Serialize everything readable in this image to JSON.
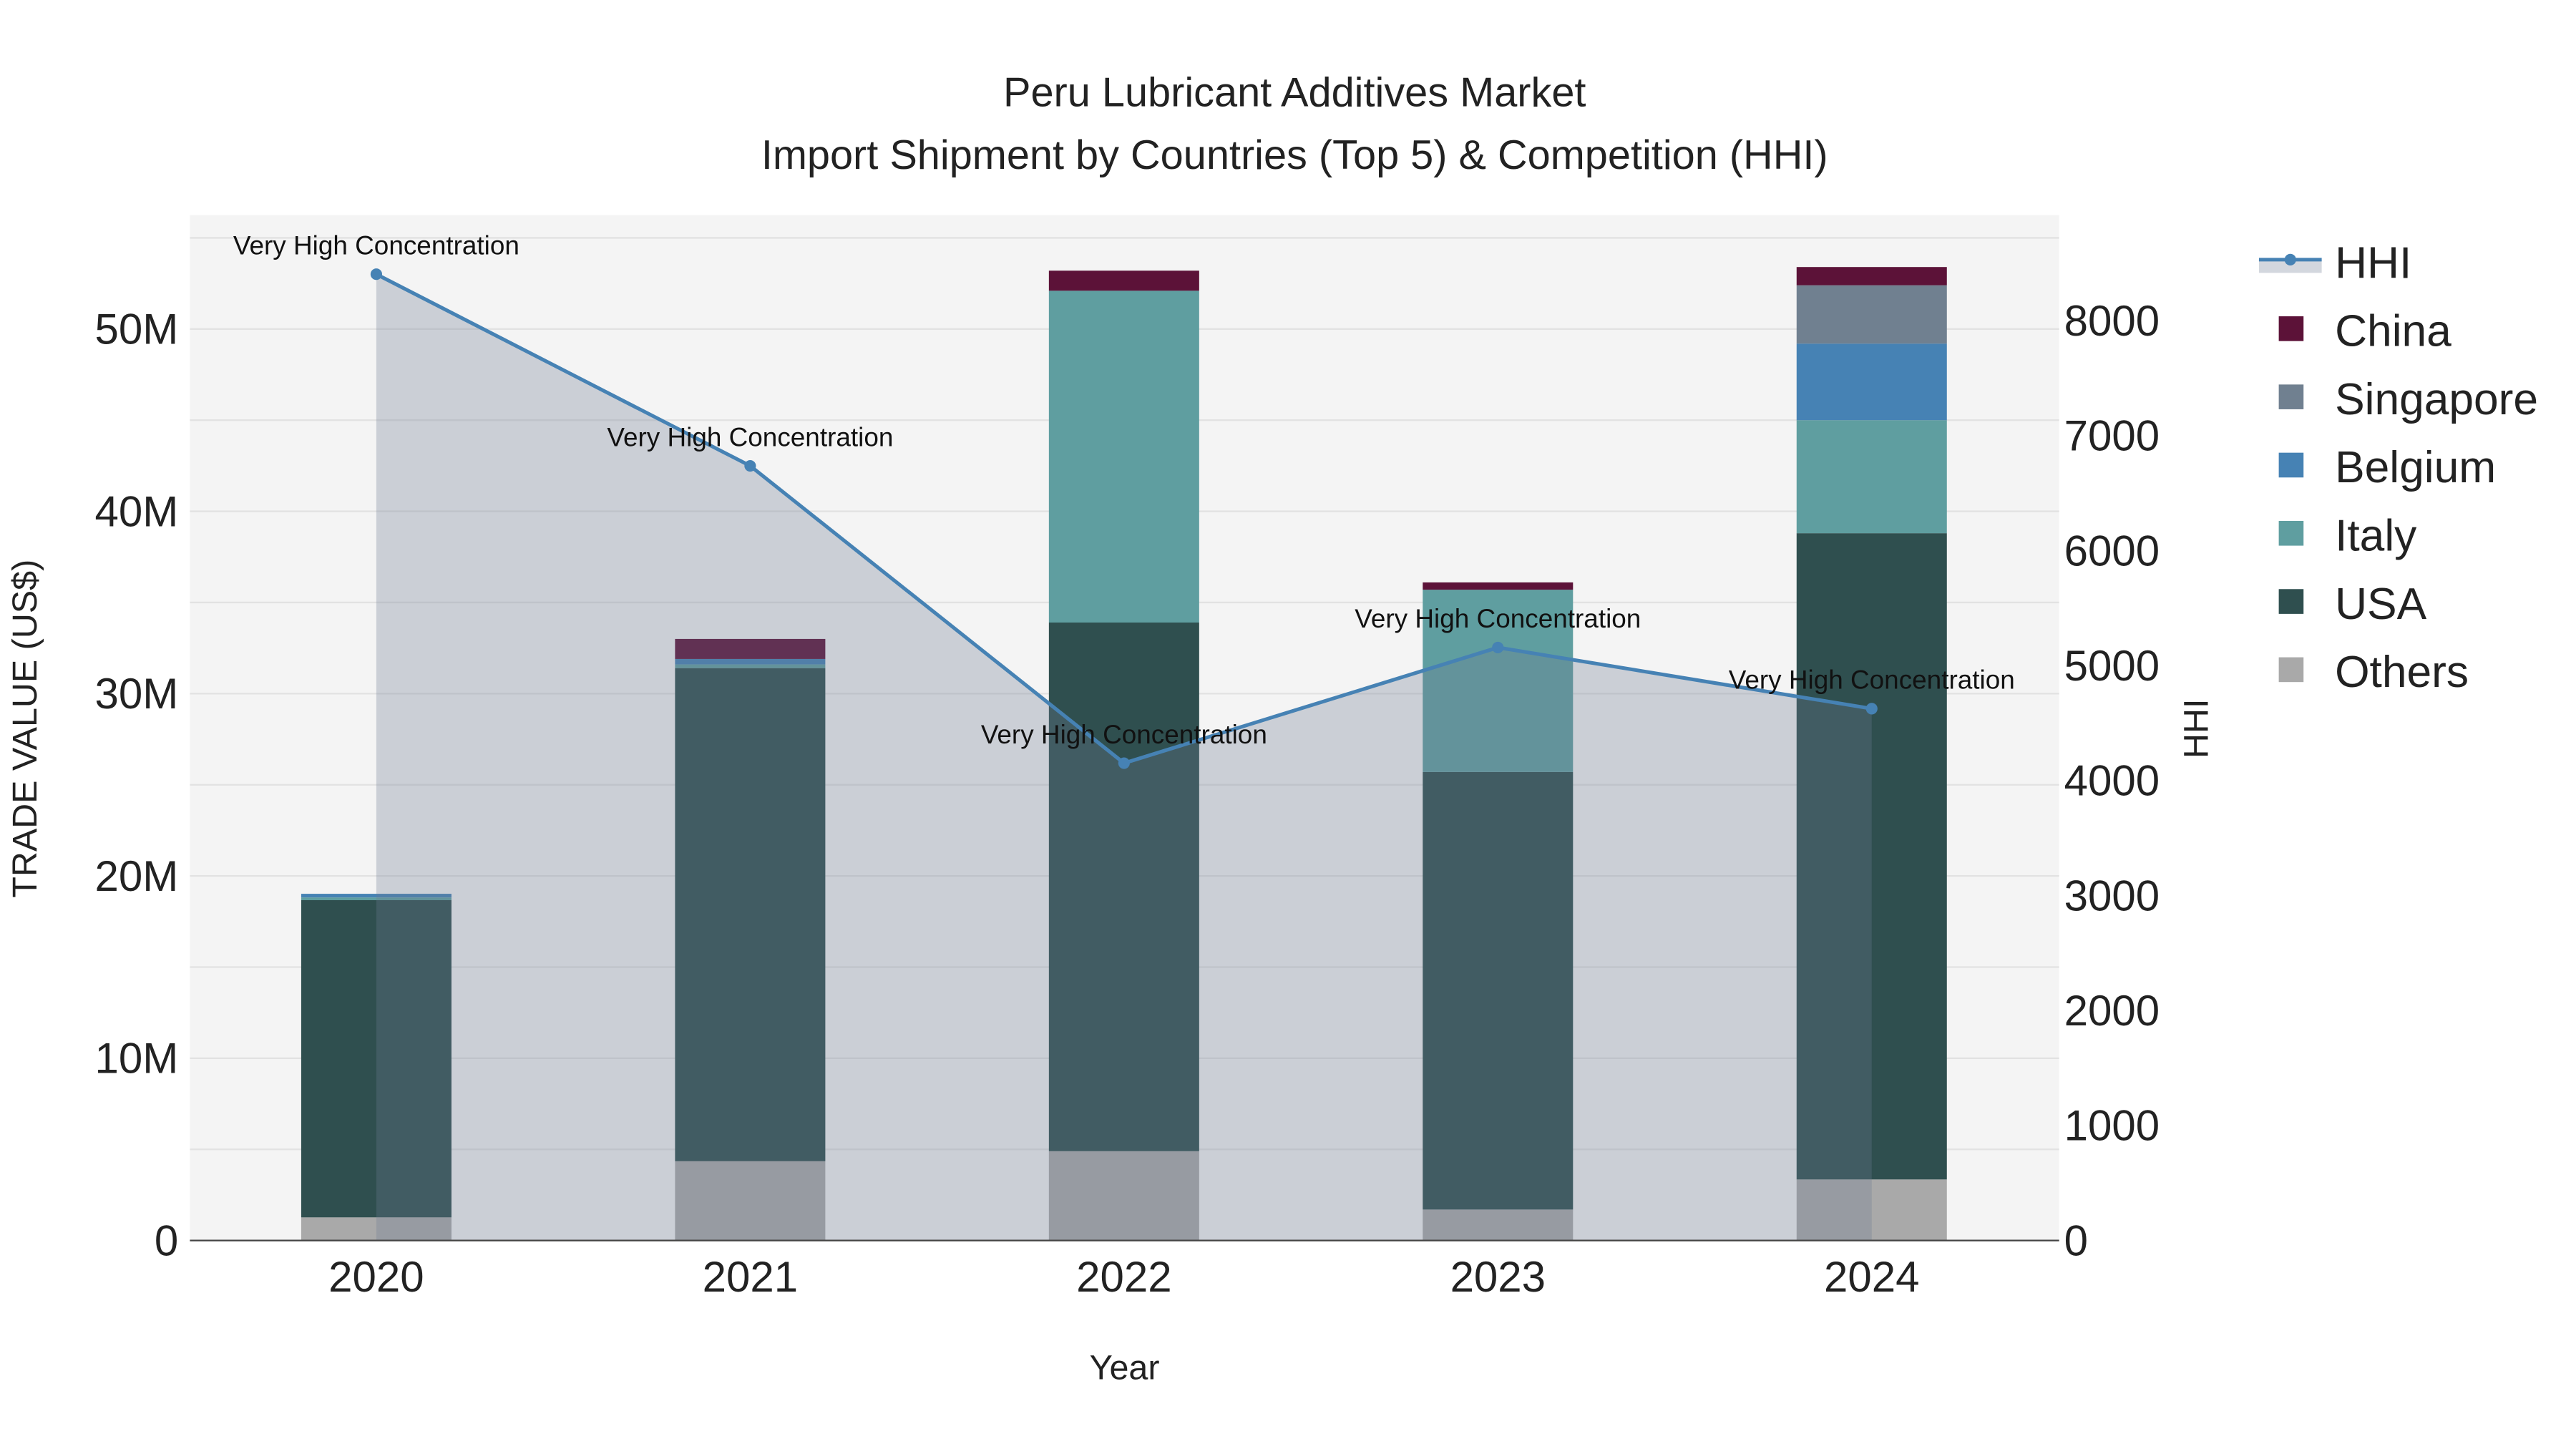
{
  "chart_data": {
    "type": "bar",
    "title_line1": "Peru Lubricant Additives Market",
    "title_line2": "Import Shipment by Countries (Top 5) & Competition (HHI)",
    "xlabel": "Year",
    "ylabel": "TRADE VALUE (US$)",
    "y2label": "HHI",
    "categories": [
      "2020",
      "2021",
      "2022",
      "2023",
      "2024"
    ],
    "ylim": [
      0,
      56000000
    ],
    "y2lim": [
      0,
      8930
    ],
    "yticks": [
      {
        "v": 0,
        "label": "0"
      },
      {
        "v": 10000000,
        "label": "10M"
      },
      {
        "v": 20000000,
        "label": "20M"
      },
      {
        "v": 30000000,
        "label": "30M"
      },
      {
        "v": 40000000,
        "label": "40M"
      },
      {
        "v": 50000000,
        "label": "50M"
      }
    ],
    "y2ticks": [
      {
        "v": 0,
        "label": "0"
      },
      {
        "v": 1000,
        "label": "1000"
      },
      {
        "v": 2000,
        "label": "2000"
      },
      {
        "v": 3000,
        "label": "3000"
      },
      {
        "v": 4000,
        "label": "4000"
      },
      {
        "v": 5000,
        "label": "5000"
      },
      {
        "v": 6000,
        "label": "6000"
      },
      {
        "v": 7000,
        "label": "7000"
      },
      {
        "v": 8000,
        "label": "8000"
      }
    ],
    "series": [
      {
        "name": "Others",
        "color": "#a9a9a9",
        "values": [
          1270000,
          4350000,
          4900000,
          1700000,
          3350000
        ]
      },
      {
        "name": "USA",
        "color": "#2f4f4f",
        "values": [
          17400000,
          27050000,
          29000000,
          24000000,
          35450000
        ]
      },
      {
        "name": "Italy",
        "color": "#5f9ea0",
        "values": [
          150000,
          200000,
          18200000,
          10000000,
          6200000
        ]
      },
      {
        "name": "Belgium",
        "color": "#4682b4",
        "values": [
          200000,
          300000,
          0,
          0,
          4200000
        ]
      },
      {
        "name": "Singapore",
        "color": "#708090",
        "values": [
          0,
          0,
          0,
          0,
          3200000
        ]
      },
      {
        "name": "China",
        "color": "#5c1238",
        "values": [
          0,
          1100000,
          1100000,
          400000,
          1000000
        ]
      }
    ],
    "hhi": {
      "name": "HHI",
      "color": "#4682b4",
      "values": [
        8405,
        6738,
        4152,
        5158,
        4626
      ],
      "annotations": [
        "Very High Concentration",
        "Very High Concentration",
        "Very High Concentration",
        "Very High Concentration",
        "Very High Concentration"
      ]
    },
    "legend": [
      "HHI",
      "China",
      "Singapore",
      "Belgium",
      "Italy",
      "USA",
      "Others"
    ],
    "legend_placement": "right"
  }
}
